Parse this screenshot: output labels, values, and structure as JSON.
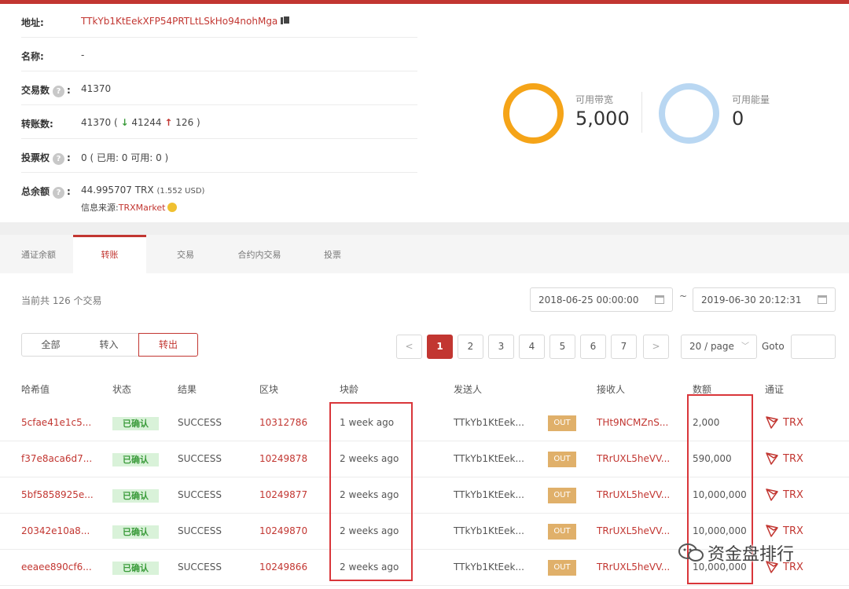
{
  "account": {
    "address_label": "地址:",
    "address": "TTkYb1KtEekXFP54PRTLtLSkHo94nohMga",
    "name_label": "名称:",
    "name": "-",
    "tx_count_label": "交易数",
    "tx_count": "41370",
    "transfer_label": "转账数:",
    "transfer_total": "41370 (",
    "transfer_in": "41244",
    "transfer_out": "126 )",
    "vote_label": "投票权",
    "vote_value": "0 ( 已用: 0  可用: 0 )",
    "balance_label": "总余额",
    "balance": "44.995707 TRX",
    "balance_usd": "(1.552 USD)",
    "source_label": "信息来源:",
    "source_link": "TRXMarket",
    "question_mark": "?"
  },
  "resources": {
    "bandwidth_label": "可用带宽",
    "bandwidth_value": "5,000",
    "energy_label": "可用能量",
    "energy_value": "0"
  },
  "tabs": [
    "通证余额",
    "转账",
    "交易",
    "合约内交易",
    "投票"
  ],
  "filters": {
    "total_text": "当前共 126 个交易",
    "date_from": "2018-06-25 00:00:00",
    "date_separator": "~",
    "date_to": "2019-06-30 20:12:31",
    "buttons": [
      "全部",
      "转入",
      "转出"
    ]
  },
  "pagination": {
    "prev": "<",
    "pages": [
      "1",
      "2",
      "3",
      "4",
      "5",
      "6",
      "7"
    ],
    "next": ">",
    "page_size": "20 / page",
    "goto_label": "Goto"
  },
  "table": {
    "headers": [
      "哈希值",
      "状态",
      "结果",
      "区块",
      "块龄",
      "发送人",
      "接收人",
      "数额",
      "通证"
    ],
    "rows": [
      {
        "hash": "5cfae41e1c5...",
        "status": "已确认",
        "result": "SUCCESS",
        "block": "10312786",
        "age": "1 week ago",
        "from": "TTkYb1KtEek...",
        "direction": "OUT",
        "to": "THt9NCMZnS...",
        "amount": "2,000",
        "token": "TRX"
      },
      {
        "hash": "f37e8aca6d7...",
        "status": "已确认",
        "result": "SUCCESS",
        "block": "10249878",
        "age": "2 weeks ago",
        "from": "TTkYb1KtEek...",
        "direction": "OUT",
        "to": "TRrUXL5heVV...",
        "amount": "590,000",
        "token": "TRX"
      },
      {
        "hash": "5bf5858925e...",
        "status": "已确认",
        "result": "SUCCESS",
        "block": "10249877",
        "age": "2 weeks ago",
        "from": "TTkYb1KtEek...",
        "direction": "OUT",
        "to": "TRrUXL5heVV...",
        "amount": "10,000,000",
        "token": "TRX"
      },
      {
        "hash": "20342e10a8...",
        "status": "已确认",
        "result": "SUCCESS",
        "block": "10249870",
        "age": "2 weeks ago",
        "from": "TTkYb1KtEek...",
        "direction": "OUT",
        "to": "TRrUXL5heVV...",
        "amount": "10,000,000",
        "token": "TRX"
      },
      {
        "hash": "eeaee890cf6...",
        "status": "已确认",
        "result": "SUCCESS",
        "block": "10249866",
        "age": "2 weeks ago",
        "from": "TTkYb1KtEek...",
        "direction": "OUT",
        "to": "TRrUXL5heVV...",
        "amount": "10,000,000",
        "token": "TRX"
      }
    ]
  },
  "watermark": "资金盘排行",
  "colors": {
    "accent": "#c23631",
    "bandwidth_ring": "#f5a418",
    "energy_ring": "#b9d7f2",
    "status_badge": "#d9f2d9",
    "out_badge": "#e0b06a",
    "highlight": "#d9363a"
  }
}
